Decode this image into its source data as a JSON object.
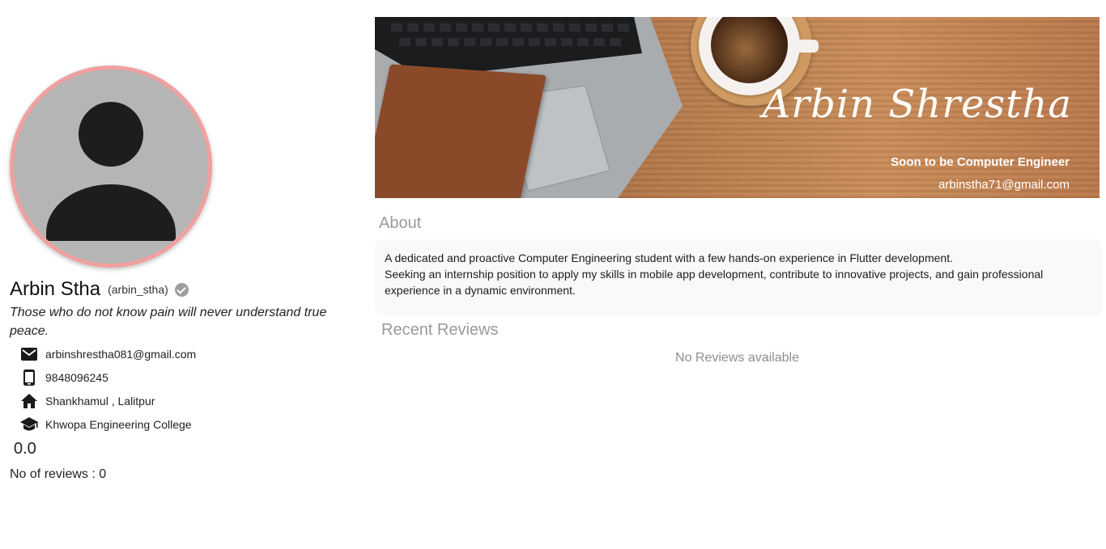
{
  "profile": {
    "name": "Arbin Stha",
    "username": "(arbin_stha)",
    "bio": "Those who do not know pain will never understand true peace.",
    "verified_icon": "verified-check-icon",
    "contacts": [
      {
        "icon": "mail-icon",
        "text": "arbinshrestha081@gmail.com"
      },
      {
        "icon": "phone-icon",
        "text": "9848096245"
      },
      {
        "icon": "home-icon",
        "text": "Shankhamul , Lalitpur"
      },
      {
        "icon": "school-icon",
        "text": "Khwopa Engineering College"
      }
    ],
    "rating": "0.0",
    "review_count": "No of reviews : 0"
  },
  "banner": {
    "signature": "Arbin Shrestha",
    "tagline": "Soon to be Computer Engineer",
    "email": "arbinstha71@gmail.com"
  },
  "about": {
    "heading": "About",
    "line1": "A dedicated and proactive Computer Engineering student with a few hands-on experience in Flutter development.",
    "line2": "Seeking an internship position to apply my skills in mobile app development, contribute to innovative projects, and gain professional experience in a dynamic environment."
  },
  "reviews": {
    "heading": "Recent Reviews",
    "empty_text": "No Reviews available"
  },
  "colors": {
    "avatar_ring": "#f0a0a0",
    "avatar_bg": "#b5b5b5",
    "heading_gray": "#9a9a9a"
  }
}
